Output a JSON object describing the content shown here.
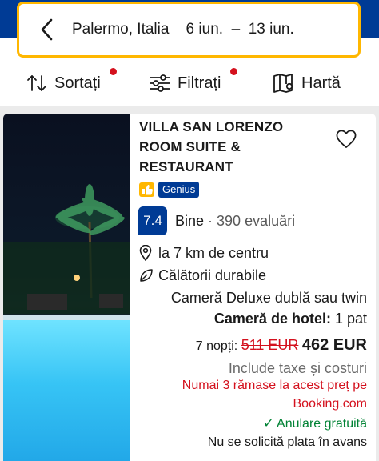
{
  "search": {
    "summary": "Palermo, Italia    6 iun.  –  13 iun."
  },
  "actions": {
    "sort_label": "Sortați",
    "filter_label": "Filtrați",
    "map_label": "Hartă"
  },
  "colors": {
    "brand_blue": "#003b95",
    "accent_yellow": "#ffb700",
    "alert_red": "#d4111e",
    "success_green": "#008234"
  },
  "property": {
    "name": "VILLA SAN LORENZO ROOM SUITE & RESTAURANT",
    "genius_badge": "Genius",
    "score": "7.4",
    "rating_word": "Bine",
    "rating_separator": " · ",
    "review_count": "390 evaluări",
    "distance": "la 7 km de centru",
    "sustainability": "Călătorii durabile",
    "room_type": "Cameră Deluxe dublă sau twin",
    "bed_label": "Cameră de hotel:",
    "bed_value": " 1 pat",
    "nights": "7 nopți:",
    "old_price": "511 EUR",
    "price": "462 EUR",
    "taxes_note": "Include taxe și costuri",
    "scarcity_line1": "Numai 3 rămase la acest preț pe",
    "scarcity_line2": "Booking.com",
    "cancellation": "Anulare gratuită",
    "prepayment": "Nu se solicită plata în avans"
  }
}
